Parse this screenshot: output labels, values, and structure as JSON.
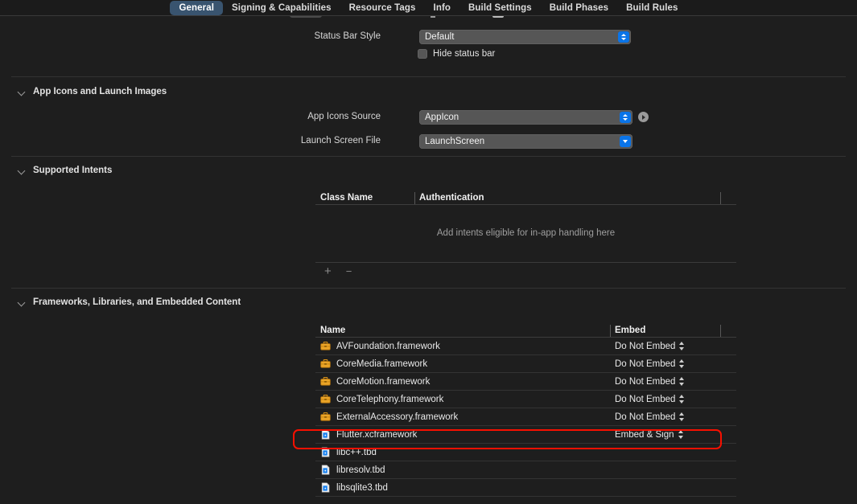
{
  "tabs": [
    {
      "label": "General",
      "active": true
    },
    {
      "label": "Signing & Capabilities",
      "active": false
    },
    {
      "label": "Resource Tags",
      "active": false
    },
    {
      "label": "Info",
      "active": false
    },
    {
      "label": "Build Settings",
      "active": false
    },
    {
      "label": "Build Phases",
      "active": false
    },
    {
      "label": "Build Rules",
      "active": false
    }
  ],
  "status_bar": {
    "style_label": "Status Bar Style",
    "style_value": "Default",
    "hide_label": "Hide status bar"
  },
  "app_icons": {
    "section_title": "App Icons and Launch Images",
    "source_label": "App Icons Source",
    "source_value": "AppIcon",
    "launch_label": "Launch Screen File",
    "launch_value": "LaunchScreen"
  },
  "supported_intents": {
    "section_title": "Supported Intents",
    "columns": [
      "Class Name",
      "Authentication"
    ],
    "empty_message": "Add intents eligible for in-app handling here",
    "add_label": "+",
    "remove_label": "−"
  },
  "frameworks": {
    "section_title": "Frameworks, Libraries, and Embedded Content",
    "columns": [
      "Name",
      "Embed"
    ],
    "rows": [
      {
        "icon": "framework-briefcase-icon",
        "name": "AVFoundation.framework",
        "embed": "Do Not Embed",
        "highlighted": false
      },
      {
        "icon": "framework-briefcase-icon",
        "name": "CoreMedia.framework",
        "embed": "Do Not Embed",
        "highlighted": false
      },
      {
        "icon": "framework-briefcase-icon",
        "name": "CoreMotion.framework",
        "embed": "Do Not Embed",
        "highlighted": false
      },
      {
        "icon": "framework-briefcase-icon",
        "name": "CoreTelephony.framework",
        "embed": "Do Not Embed",
        "highlighted": false
      },
      {
        "icon": "framework-briefcase-icon",
        "name": "ExternalAccessory.framework",
        "embed": "Do Not Embed",
        "highlighted": false
      },
      {
        "icon": "document-blue-icon",
        "name": "Flutter.xcframework",
        "embed": "Embed & Sign",
        "highlighted": true
      },
      {
        "icon": "document-blue-icon",
        "name": "libc++.tbd",
        "embed": "",
        "highlighted": false
      },
      {
        "icon": "document-blue-icon",
        "name": "libresolv.tbd",
        "embed": "",
        "highlighted": false
      },
      {
        "icon": "document-blue-icon",
        "name": "libsqlite3.tbd",
        "embed": "",
        "highlighted": false
      }
    ]
  },
  "colors": {
    "background": "#1e1e1e",
    "tab_active": "#39546f",
    "control_accent": "#0a74e8",
    "highlight_annotation": "#f81000",
    "framework_icon": "#e8a020"
  }
}
